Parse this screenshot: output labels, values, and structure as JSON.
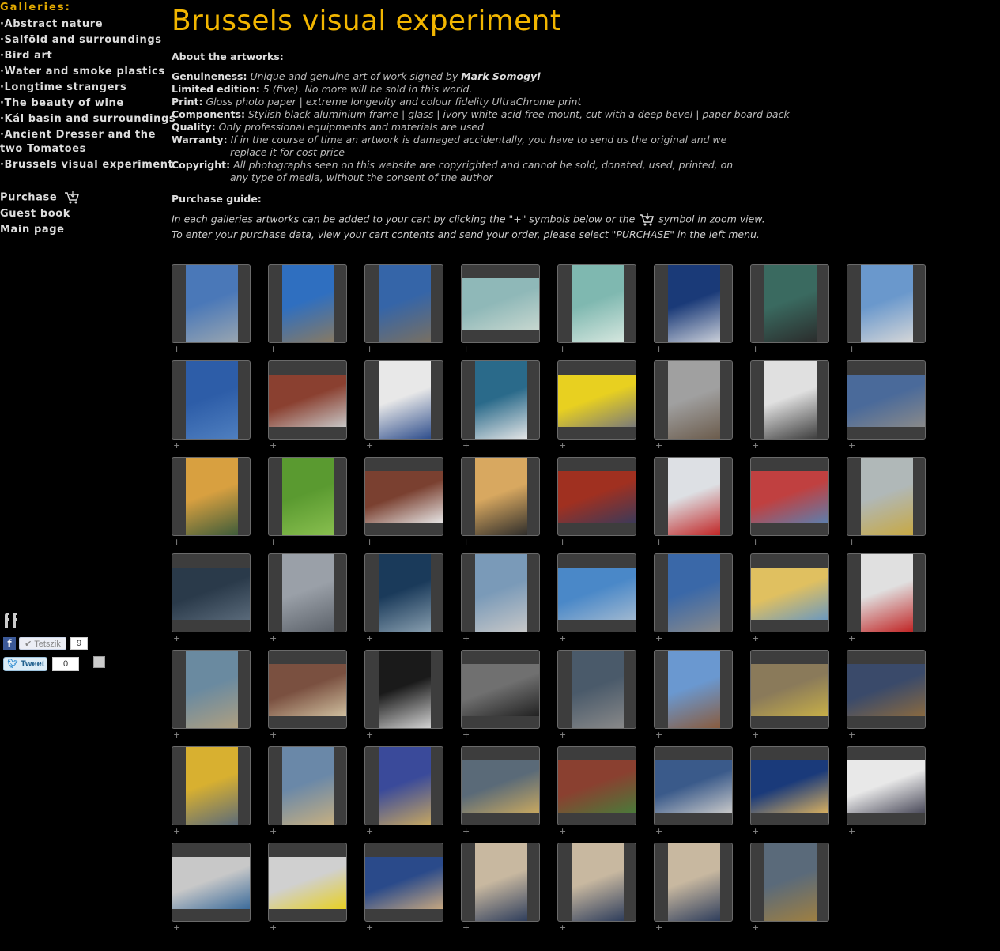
{
  "menu": {
    "heading": "Galleries:",
    "galleries": [
      "·Abstract nature",
      "·Salföld and surroundings",
      "·Bird art",
      "·Water and smoke plastics",
      "·Longtime strangers",
      "·The beauty of wine",
      "·Kál basin and surroundings",
      "·Ancient Dresser and the two Tomatoes",
      "·Brussels visual experiment"
    ],
    "purchase": "Purchase",
    "guestbook": "Guest book",
    "mainpage": "Main page"
  },
  "social": {
    "fb_letter": "f",
    "like_label": "✔ Tetszik",
    "like_count": "9",
    "tweet_label": "Tweet",
    "tweet_count": "0"
  },
  "page": {
    "title": "Brussels visual experiment",
    "about_heading": "About the artworks:",
    "details": [
      {
        "label": "Genuineness:",
        "text": "Unique and genuine art of work signed by",
        "strong": "Mark Somogyi"
      },
      {
        "label": "Limited edition:",
        "text": "5 (five). No more will be sold in this world."
      },
      {
        "label": "Print:",
        "text": "Gloss photo paper | extreme longevity and colour fidelity UltraChrome print"
      },
      {
        "label": "Components:",
        "text": "Stylish black aluminium frame | glass | ivory-white acid free mount, cut with a deep bevel | paper board back"
      },
      {
        "label": "Quality:",
        "text": "Only professional equipments and materials are used"
      },
      {
        "label": "Warranty:",
        "text": "If in the course of time an artwork is damaged accidentally, you have to send us the original and we",
        "cont": "replace it for cost price"
      },
      {
        "label": "Copyright:",
        "text": "All photographs seen on this website are copyrighted and cannot be sold, donated, used, printed, on",
        "cont": "any type of media, without the consent of the author"
      }
    ],
    "guide_heading": "Purchase guide:",
    "guide_line1a": "In each galleries artworks can be added to your cart by clicking the \"+\" symbols below or the",
    "guide_line1b": "symbol in zoom view.",
    "guide_line2": "To enter your purchase data, view your cart contents and send your order, please select \"PURCHASE\" in the left menu."
  },
  "gallery": {
    "add_symbol": "+",
    "thumbs": [
      {
        "o": "p",
        "c1": "#4a78b8",
        "c2": "#9aa6b0"
      },
      {
        "o": "p",
        "c1": "#2f6fc0",
        "c2": "#8a7a60"
      },
      {
        "o": "p",
        "c1": "#3565a8",
        "c2": "#7a7060"
      },
      {
        "o": "l",
        "c1": "#8fb8b8",
        "c2": "#c8d8d0"
      },
      {
        "o": "p",
        "c1": "#7fb8b0",
        "c2": "#d8e8e0"
      },
      {
        "o": "p",
        "c1": "#1a3a78",
        "c2": "#d0d4dc"
      },
      {
        "o": "p",
        "c1": "#3a6a60",
        "c2": "#2a2a2a"
      },
      {
        "o": "p",
        "c1": "#6a98cc",
        "c2": "#d8d8d8"
      },
      {
        "o": "p",
        "c1": "#2d5da8",
        "c2": "#5080c0"
      },
      {
        "o": "l",
        "c1": "#8a4030",
        "c2": "#c8c8c8"
      },
      {
        "o": "p",
        "c1": "#e8e8e8",
        "c2": "#2a4a8a"
      },
      {
        "o": "p",
        "c1": "#2a6a8a",
        "c2": "#e8e8e8"
      },
      {
        "o": "l",
        "c1": "#e8d020",
        "c2": "#7a7a7a"
      },
      {
        "o": "p",
        "c1": "#a0a0a0",
        "c2": "#6a5a4a"
      },
      {
        "o": "p",
        "c1": "#e0e0e0",
        "c2": "#3a3a3a"
      },
      {
        "o": "l",
        "c1": "#4a6a9a",
        "c2": "#8a8a8a"
      },
      {
        "o": "p",
        "c1": "#d8a040",
        "c2": "#3a5a3a"
      },
      {
        "o": "p",
        "c1": "#5a9a30",
        "c2": "#8ac050"
      },
      {
        "o": "l",
        "c1": "#7a4030",
        "c2": "#e8e8e8"
      },
      {
        "o": "p",
        "c1": "#d8a860",
        "c2": "#2a2a2a"
      },
      {
        "o": "l",
        "c1": "#a03020",
        "c2": "#3a3a5a"
      },
      {
        "o": "p",
        "c1": "#dde0e4",
        "c2": "#c02020"
      },
      {
        "o": "l",
        "c1": "#c04040",
        "c2": "#5a80b0"
      },
      {
        "o": "p",
        "c1": "#b0b8b8",
        "c2": "#c8a840"
      },
      {
        "o": "l",
        "c1": "#2a3a4a",
        "c2": "#5a6a7a"
      },
      {
        "o": "p",
        "c1": "#9aa0a8",
        "c2": "#5a6068"
      },
      {
        "o": "p",
        "c1": "#1a3a5a",
        "c2": "#8aa0b0"
      },
      {
        "o": "p",
        "c1": "#7a9ab8",
        "c2": "#c8c8c8"
      },
      {
        "o": "l",
        "c1": "#4a88c8",
        "c2": "#a0b8d0"
      },
      {
        "o": "p",
        "c1": "#3a68a8",
        "c2": "#8a8a8a"
      },
      {
        "o": "l",
        "c1": "#e0c060",
        "c2": "#6a98c0"
      },
      {
        "o": "p",
        "c1": "#e0e0e0",
        "c2": "#c02020"
      },
      {
        "o": "p",
        "c1": "#6a8aa0",
        "c2": "#b0a080"
      },
      {
        "o": "l",
        "c1": "#7a5040",
        "c2": "#d0c0a0"
      },
      {
        "o": "p",
        "c1": "#1a1a1a",
        "c2": "#d8d8d8"
      },
      {
        "o": "l",
        "c1": "#707070",
        "c2": "#202020"
      },
      {
        "o": "p",
        "c1": "#4a5a6a",
        "c2": "#8a8a8a"
      },
      {
        "o": "p",
        "c1": "#6a98d0",
        "c2": "#8a5a3a"
      },
      {
        "o": "l",
        "c1": "#8a7a5a",
        "c2": "#c8b048"
      },
      {
        "o": "l",
        "c1": "#3a4a6a",
        "c2": "#8a6a40"
      },
      {
        "o": "p",
        "c1": "#d8b030",
        "c2": "#5a6a7a"
      },
      {
        "o": "p",
        "c1": "#6a88a8",
        "c2": "#c8b080"
      },
      {
        "o": "p",
        "c1": "#3a4a9a",
        "c2": "#c8a860"
      },
      {
        "o": "l",
        "c1": "#5a6a78",
        "c2": "#c8a860"
      },
      {
        "o": "l",
        "c1": "#8a4030",
        "c2": "#4a7a3a"
      },
      {
        "o": "l",
        "c1": "#3a5a8a",
        "c2": "#c8c8c8"
      },
      {
        "o": "l",
        "c1": "#1a3a7a",
        "c2": "#d8b060"
      },
      {
        "o": "l",
        "c1": "#e8e8e8",
        "c2": "#4a4a5a"
      },
      {
        "o": "l",
        "c1": "#c8c8c8",
        "c2": "#3a6a9a"
      },
      {
        "o": "l",
        "c1": "#d0d0d0",
        "c2": "#e8d020"
      },
      {
        "o": "l",
        "c1": "#2a4a8a",
        "c2": "#c8a880"
      },
      {
        "o": "p",
        "c1": "#c8b8a0",
        "c2": "#2a3a5a"
      },
      {
        "o": "p",
        "c1": "#c8b8a0",
        "c2": "#2a3a5a"
      },
      {
        "o": "p",
        "c1": "#c8b8a0",
        "c2": "#2a3a5a"
      },
      {
        "o": "p",
        "c1": "#5a6a7a",
        "c2": "#a08040"
      }
    ]
  }
}
